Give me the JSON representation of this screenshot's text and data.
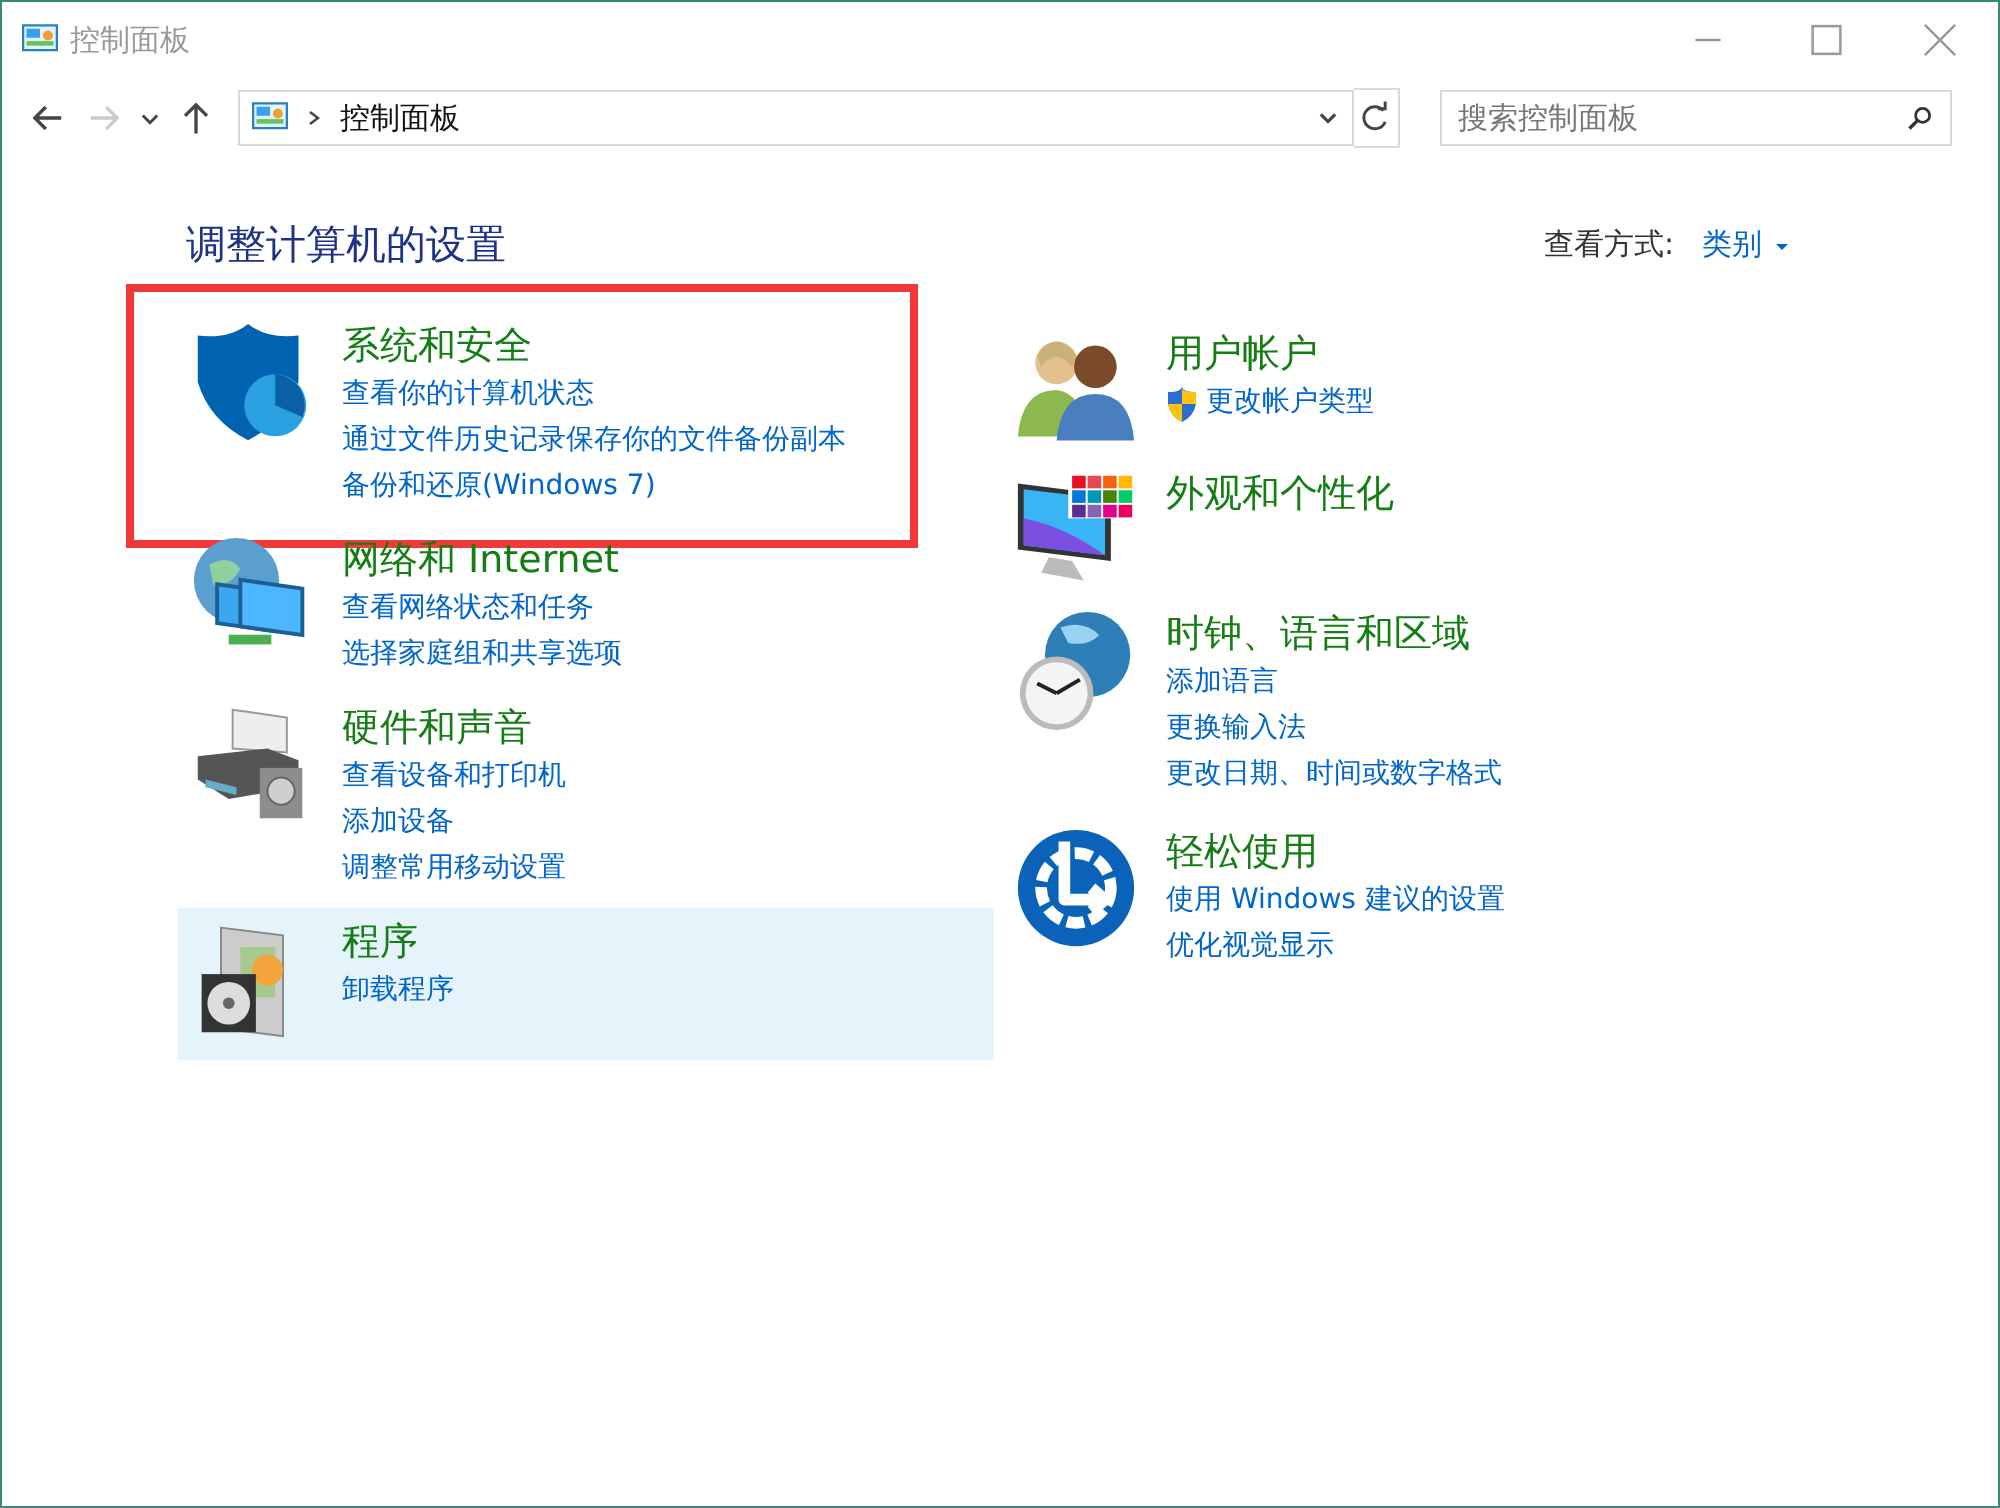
{
  "window": {
    "title": "控制面板"
  },
  "address_bar": {
    "path": "控制面板"
  },
  "search": {
    "placeholder": "搜索控制面板"
  },
  "heading": "调整计算机的设置",
  "view_by": {
    "label": "查看方式:",
    "value": "类别"
  },
  "left_categories": [
    {
      "kind": "security",
      "title": "系统和安全",
      "highlighted": true,
      "hovered": false,
      "links": [
        {
          "text": "查看你的计算机状态"
        },
        {
          "text": "通过文件历史记录保存你的文件备份副本"
        },
        {
          "text": "备份和还原(Windows 7)"
        }
      ]
    },
    {
      "kind": "network",
      "title": "网络和 Internet",
      "highlighted": false,
      "hovered": false,
      "links": [
        {
          "text": "查看网络状态和任务"
        },
        {
          "text": "选择家庭组和共享选项"
        }
      ]
    },
    {
      "kind": "hardware",
      "title": "硬件和声音",
      "highlighted": false,
      "hovered": false,
      "links": [
        {
          "text": "查看设备和打印机"
        },
        {
          "text": "添加设备"
        },
        {
          "text": "调整常用移动设置"
        }
      ]
    },
    {
      "kind": "programs",
      "title": "程序",
      "highlighted": false,
      "hovered": true,
      "links": [
        {
          "text": "卸载程序"
        }
      ]
    }
  ],
  "right_categories": [
    {
      "kind": "users",
      "title": "用户帐户",
      "highlighted": false,
      "hovered": false,
      "links": [
        {
          "text": "更改帐户类型",
          "shield": true
        }
      ]
    },
    {
      "kind": "appearance",
      "title": "外观和个性化",
      "highlighted": false,
      "hovered": false
    },
    {
      "kind": "clock",
      "title": "时钟、语言和区域",
      "highlighted": false,
      "hovered": false,
      "links": [
        {
          "text": "添加语言"
        },
        {
          "text": "更换输入法"
        },
        {
          "text": "更改日期、时间或数字格式"
        }
      ]
    },
    {
      "kind": "ease",
      "title": "轻松使用",
      "highlighted": false,
      "hovered": false,
      "links": [
        {
          "text": "使用 Windows 建议的设置"
        },
        {
          "text": "优化视觉显示"
        }
      ]
    }
  ]
}
